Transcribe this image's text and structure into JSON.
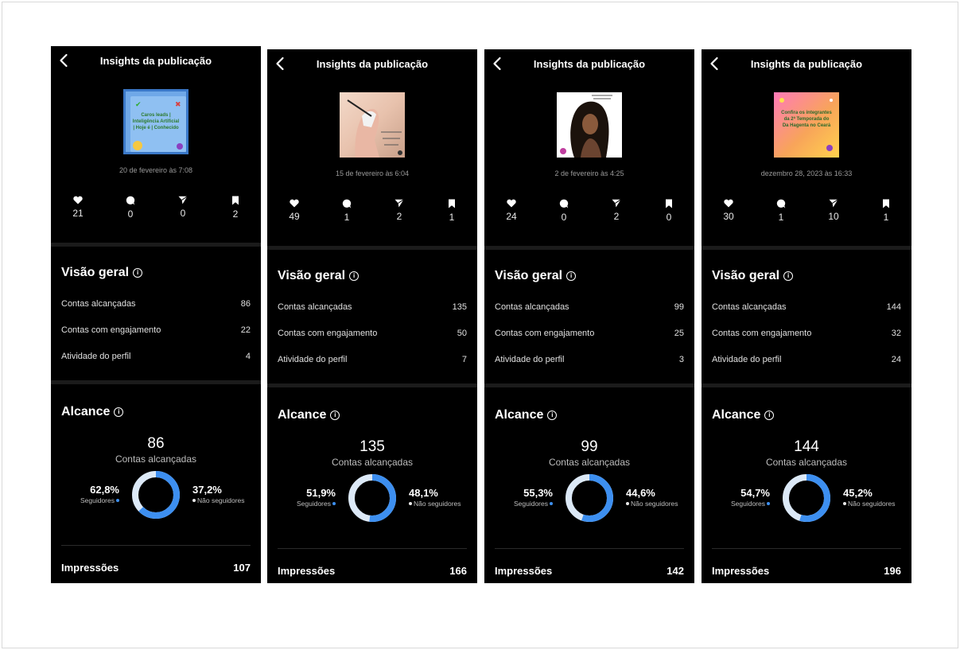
{
  "screens": [
    {
      "title": "Insights da publicação",
      "thumb_text": "Caros leads | Inteligência Artificial | Hoje é | Conhecido",
      "date": "20 de fevereiro às 7:08",
      "likes": "21",
      "comments": "0",
      "shares": "0",
      "saves": "2",
      "overview_title": "Visão geral",
      "reached_label": "Contas alcançadas",
      "reached_value": "86",
      "engaged_label": "Contas com engajamento",
      "engaged_value": "22",
      "profile_label": "Atividade do perfil",
      "profile_value": "4",
      "reach_title": "Alcance",
      "reach_number": "86",
      "reach_label": "Contas alcançadas",
      "followers_pct": "62,8%",
      "followers_label": "Seguidores",
      "followers_fraction": 0.628,
      "nonfollowers_pct": "37,2%",
      "nonfollowers_label": "Não seguidores",
      "impressions_label": "Impressões",
      "impressions_value": "107"
    },
    {
      "title": "Insights da publicação",
      "thumb_text": "",
      "date": "15 de fevereiro às 6:04",
      "likes": "49",
      "comments": "1",
      "shares": "2",
      "saves": "1",
      "overview_title": "Visão geral",
      "reached_label": "Contas alcançadas",
      "reached_value": "135",
      "engaged_label": "Contas com engajamento",
      "engaged_value": "50",
      "profile_label": "Atividade do perfil",
      "profile_value": "7",
      "reach_title": "Alcance",
      "reach_number": "135",
      "reach_label": "Contas alcançadas",
      "followers_pct": "51,9%",
      "followers_label": "Seguidores",
      "followers_fraction": 0.519,
      "nonfollowers_pct": "48,1%",
      "nonfollowers_label": "Não seguidores",
      "impressions_label": "Impressões",
      "impressions_value": "166"
    },
    {
      "title": "Insights da publicação",
      "thumb_text": "",
      "date": "2 de fevereiro às 4:25",
      "likes": "24",
      "comments": "0",
      "shares": "2",
      "saves": "0",
      "overview_title": "Visão geral",
      "reached_label": "Contas alcançadas",
      "reached_value": "99",
      "engaged_label": "Contas com engajamento",
      "engaged_value": "25",
      "profile_label": "Atividade do perfil",
      "profile_value": "3",
      "reach_title": "Alcance",
      "reach_number": "99",
      "reach_label": "Contas alcançadas",
      "followers_pct": "55,3%",
      "followers_label": "Seguidores",
      "followers_fraction": 0.553,
      "nonfollowers_pct": "44,6%",
      "nonfollowers_label": "Não seguidores",
      "impressions_label": "Impressões",
      "impressions_value": "142"
    },
    {
      "title": "Insights da publicação",
      "thumb_text": "Confira os integrantes da 2ª Temporada do Da Hagenta no Ceará",
      "date": "dezembro 28, 2023 às 16:33",
      "likes": "30",
      "comments": "1",
      "shares": "10",
      "saves": "1",
      "overview_title": "Visão geral",
      "reached_label": "Contas alcançadas",
      "reached_value": "144",
      "engaged_label": "Contas com engajamento",
      "engaged_value": "32",
      "profile_label": "Atividade do perfil",
      "profile_value": "24",
      "reach_title": "Alcance",
      "reach_number": "144",
      "reach_label": "Contas alcançadas",
      "followers_pct": "54,7%",
      "followers_label": "Seguidores",
      "followers_fraction": 0.547,
      "nonfollowers_pct": "45,2%",
      "nonfollowers_label": "Não seguidores",
      "impressions_label": "Impressões",
      "impressions_value": "196"
    }
  ],
  "colors": {
    "background": "#000000",
    "followers": "#3d8ff0",
    "nonfollowers": "#dce9f7",
    "text": "#ffffff",
    "muted": "#9a9a9a"
  }
}
